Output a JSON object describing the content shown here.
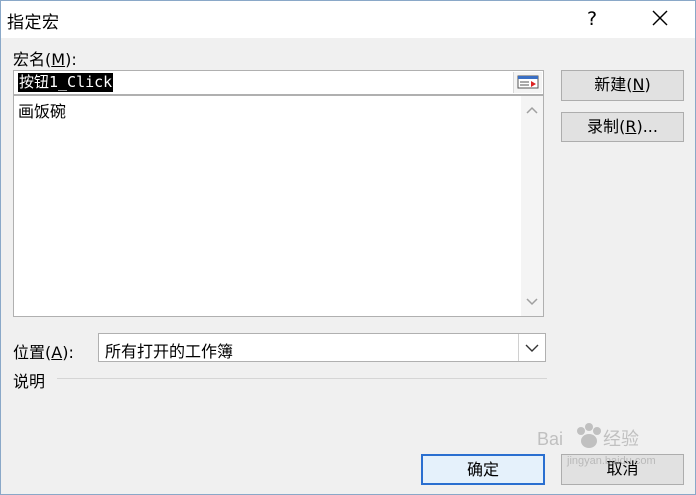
{
  "window": {
    "title": "指定宏",
    "help_glyph": "?",
    "close_icon": "close-icon"
  },
  "macro_name": {
    "label": "宏名",
    "shortcut": "M",
    "label_suffix": ":",
    "value": "按钮1_Click"
  },
  "macro_list": {
    "items": [
      "画饭碗"
    ]
  },
  "buttons": {
    "new_label": "新建",
    "new_shortcut": "N",
    "record_label": "录制",
    "record_shortcut": "R",
    "record_suffix": "...",
    "ok_label": "确定",
    "cancel_label": "取消"
  },
  "location": {
    "label": "位置",
    "shortcut": "A",
    "label_suffix": ":",
    "value": "所有打开的工作簿"
  },
  "description": {
    "label": "说明"
  },
  "watermark": {
    "url_text": "jingyan.baidu.com"
  },
  "colors": {
    "default_button_border": "#2a6fd0",
    "selection_bg": "#000000"
  }
}
